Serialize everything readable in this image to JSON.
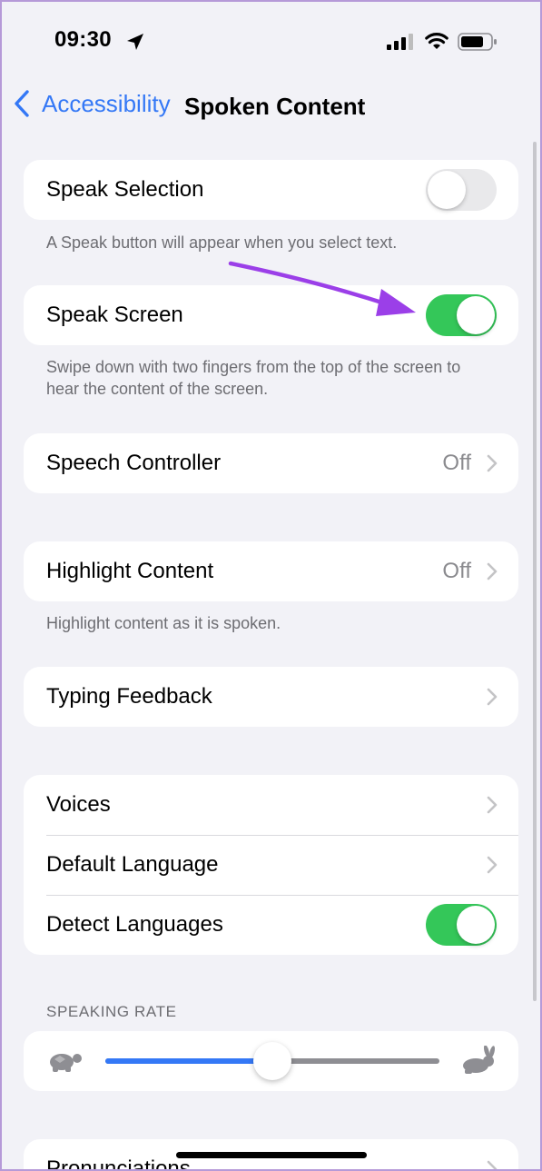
{
  "status_bar": {
    "time": "09:30",
    "icons": [
      "location-arrow-icon",
      "cellular-signal-icon",
      "wifi-icon",
      "battery-icon"
    ]
  },
  "nav": {
    "back_label": "Accessibility",
    "title": "Spoken Content"
  },
  "speak_selection": {
    "label": "Speak Selection",
    "enabled": false,
    "footnote": "A Speak button will appear when you select text."
  },
  "speak_screen": {
    "label": "Speak Screen",
    "enabled": true,
    "footnote": "Swipe down with two fingers from the top of the screen to hear the content of the screen."
  },
  "speech_controller": {
    "label": "Speech Controller",
    "value": "Off"
  },
  "highlight_content": {
    "label": "Highlight Content",
    "value": "Off",
    "footnote": "Highlight content as it is spoken."
  },
  "typing_feedback": {
    "label": "Typing Feedback"
  },
  "voices_group": {
    "voices_label": "Voices",
    "default_language_label": "Default Language",
    "detect_languages_label": "Detect Languages",
    "detect_languages_enabled": true
  },
  "speaking_rate": {
    "header": "SPEAKING RATE",
    "value": 0.5,
    "min_icon": "turtle-icon",
    "max_icon": "rabbit-icon"
  },
  "pronunciations": {
    "label": "Pronunciations"
  },
  "colors": {
    "accent": "#3478f6",
    "toggle_on": "#34c759",
    "background": "#f2f2f7",
    "annotation_arrow": "#9b3fe8"
  }
}
